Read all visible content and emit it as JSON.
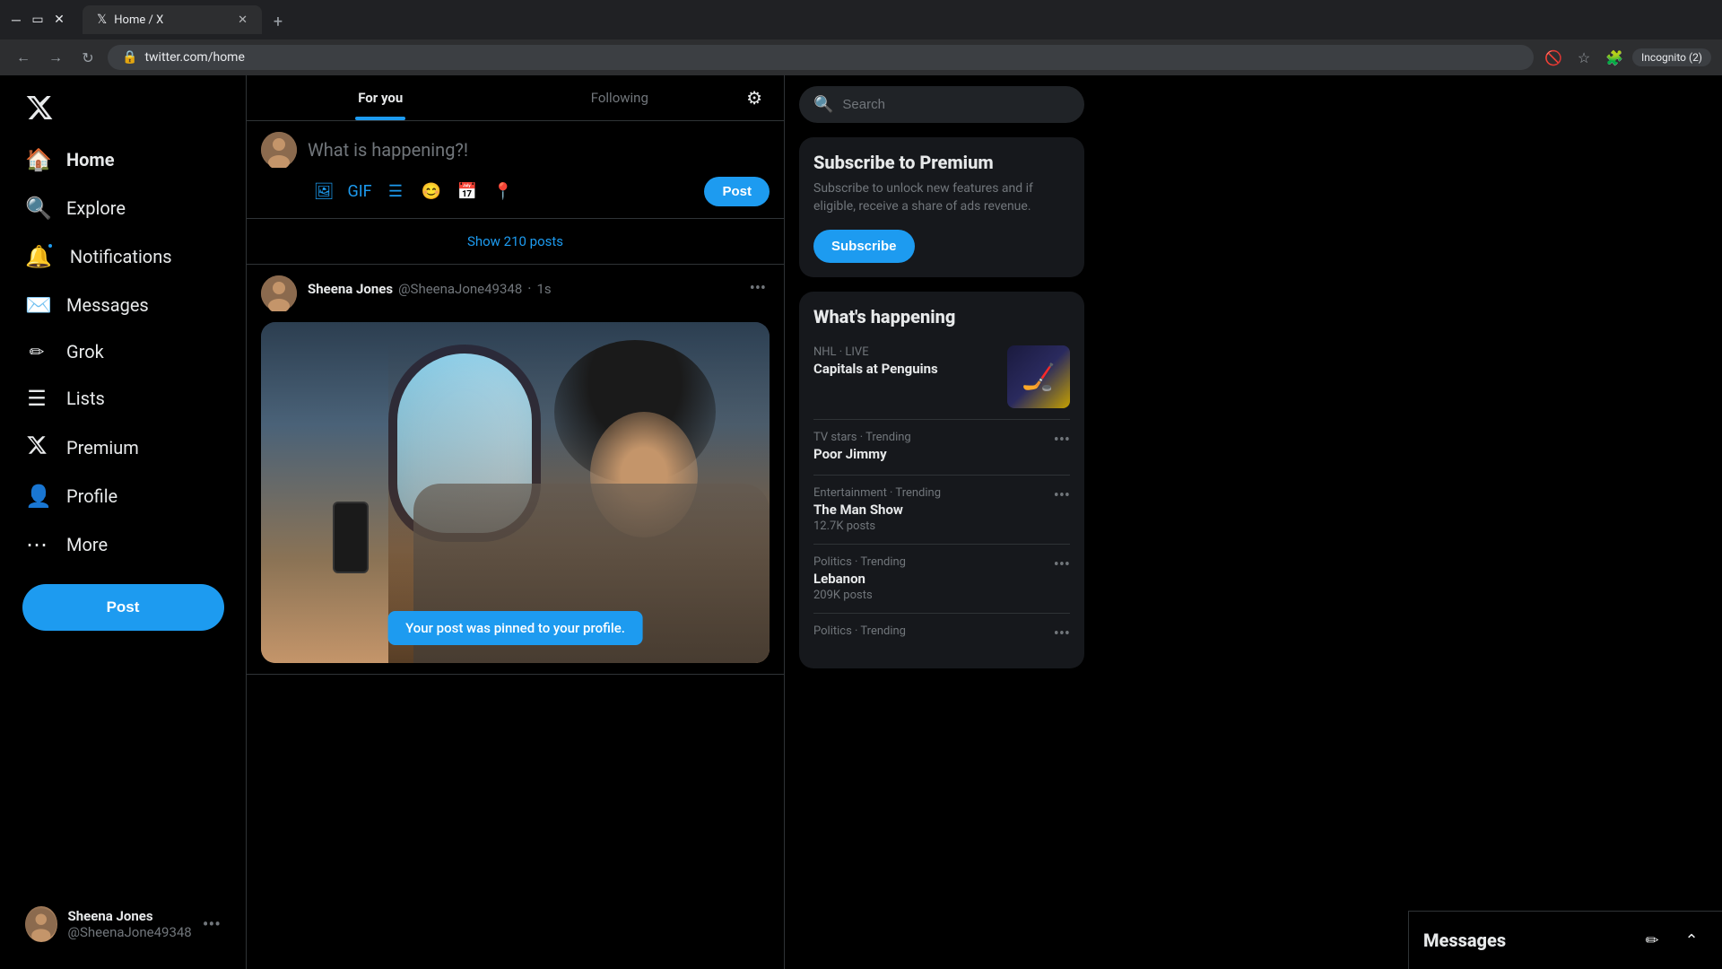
{
  "browser": {
    "tab_favicon": "𝕏",
    "tab_title": "Home / X",
    "url": "twitter.com/home",
    "incognito_label": "Incognito (2)"
  },
  "sidebar": {
    "logo_alt": "X logo",
    "nav_items": [
      {
        "id": "home",
        "label": "Home",
        "icon": "🏠",
        "active": true
      },
      {
        "id": "explore",
        "label": "Explore",
        "icon": "🔍"
      },
      {
        "id": "notifications",
        "label": "Notifications",
        "icon": "🔔"
      },
      {
        "id": "messages",
        "label": "Messages",
        "icon": "✉️"
      },
      {
        "id": "grok",
        "label": "Grok",
        "icon": "✏️"
      },
      {
        "id": "lists",
        "label": "Lists",
        "icon": "📋"
      },
      {
        "id": "premium",
        "label": "Premium",
        "icon": "✕"
      },
      {
        "id": "profile",
        "label": "Profile",
        "icon": "👤"
      },
      {
        "id": "more",
        "label": "More",
        "icon": "⋯"
      }
    ],
    "post_button_label": "Post",
    "user": {
      "display_name": "Sheena Jones",
      "handle": "@SheenaJone49348"
    }
  },
  "feed": {
    "tabs": [
      {
        "id": "for-you",
        "label": "For you",
        "active": true
      },
      {
        "id": "following",
        "label": "Following",
        "active": false
      }
    ],
    "compose_placeholder": "What is happening?!",
    "compose_post_label": "Post",
    "show_posts_label": "Show 210 posts",
    "tweet": {
      "author_name": "Sheena Jones",
      "author_handle": "@SheenaJone49348",
      "time": "1s",
      "pinned_message": "Your post was pinned to your profile."
    }
  },
  "right_sidebar": {
    "search_placeholder": "Search",
    "premium": {
      "title": "Subscribe to Premium",
      "description": "Subscribe to unlock new features and if eligible, receive a share of ads revenue.",
      "button_label": "Subscribe"
    },
    "trending_title": "What's happening",
    "trending_items": [
      {
        "category": "NHL · LIVE",
        "name": "Capitals at Penguins",
        "count": "",
        "has_image": true
      },
      {
        "category": "TV stars · Trending",
        "name": "Poor Jimmy",
        "count": ""
      },
      {
        "category": "Entertainment · Trending",
        "name": "The Man Show",
        "count": "12.7K posts"
      },
      {
        "category": "Politics · Trending",
        "name": "Lebanon",
        "count": "209K posts"
      },
      {
        "category": "Politics · Trending",
        "name": "",
        "count": ""
      }
    ]
  },
  "messages_bar": {
    "title": "Messages"
  }
}
